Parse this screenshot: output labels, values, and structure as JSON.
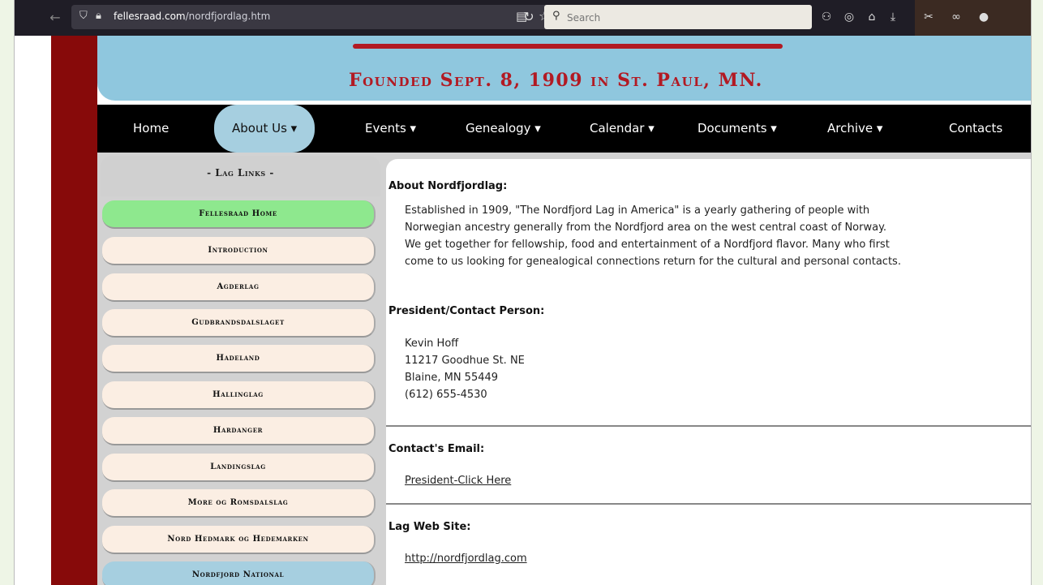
{
  "browser": {
    "url_domain": "fellesraad.com",
    "url_path": "/nordfjordlag.htm",
    "search_placeholder": "Search"
  },
  "banner": {
    "subtitle": "Founded Sept. 8, 1909 in St. Paul, MN."
  },
  "nav": {
    "items": [
      {
        "label": "Home"
      },
      {
        "label": "About Us ▾"
      },
      {
        "label": "Events ▾"
      },
      {
        "label": "Genealogy ▾"
      },
      {
        "label": "Calendar ▾"
      },
      {
        "label": "Documents ▾"
      },
      {
        "label": "Archive ▾"
      },
      {
        "label": "Contacts"
      }
    ],
    "active_index": 1
  },
  "sidebar": {
    "title": "- Lag Links -",
    "links": [
      {
        "label": "Fellesraad Home"
      },
      {
        "label": "Introduction"
      },
      {
        "label": "Agderlag"
      },
      {
        "label": "Gudbrandsdalslaget"
      },
      {
        "label": "Hadeland"
      },
      {
        "label": "Hallinglag"
      },
      {
        "label": "Hardanger"
      },
      {
        "label": "Landingslag"
      },
      {
        "label": "More og Romsdalslag"
      },
      {
        "label": "Nord Hedmark og Hedemarken"
      },
      {
        "label": "Nordfjord National"
      }
    ]
  },
  "main": {
    "about_heading": "About Nordfjordlag:",
    "about_lines": [
      "Established in 1909, \"The Nordfjord Lag in America\" is a yearly gathering of people with",
      "Norwegian ancestry generally from the Nordfjord area on the west central coast of Norway.",
      "We get together for fellowship, food and entertainment of a Nordfjord flavor. Many who first",
      "come to us looking for genealogical connections return for the cultural and personal contacts."
    ],
    "president_heading": "President/Contact Person:",
    "president_lines": [
      "Kevin Hoff",
      "11217 Goodhue St. NE",
      "Blaine, MN 55449",
      "(612) 655-4530"
    ],
    "email_heading": "Contact's Email:",
    "email_link": "President-Click Here",
    "website_heading": "Lag Web Site:",
    "website_link": "http://nordfjordlag.com"
  },
  "colors": {
    "navbar": "#000000",
    "banner": "#8fc7de",
    "accent_red": "#b21a23",
    "left_bar": "#870a0a",
    "home_link": "#8ee88e",
    "active_tab": "#a6cfe0"
  }
}
